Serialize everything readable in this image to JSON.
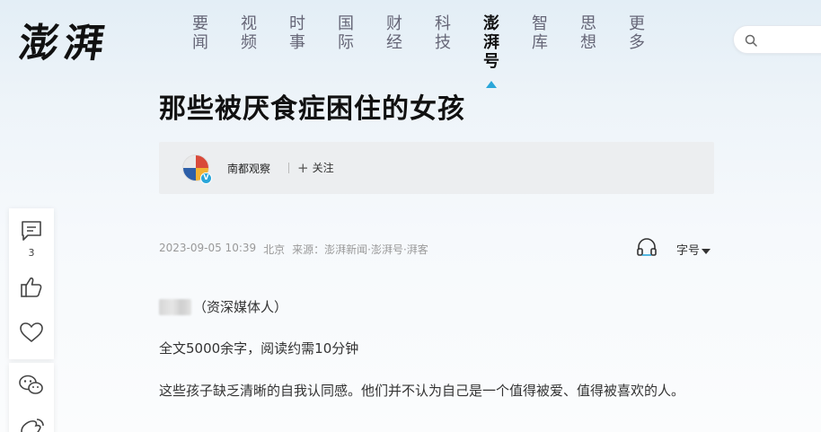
{
  "brand": {
    "logo_text": "澎湃"
  },
  "nav": {
    "items": [
      {
        "label": [
          "要",
          "闻"
        ],
        "active": false
      },
      {
        "label": [
          "视",
          "频"
        ],
        "active": false
      },
      {
        "label": [
          "时",
          "事"
        ],
        "active": false
      },
      {
        "label": [
          "国",
          "际"
        ],
        "active": false
      },
      {
        "label": [
          "财",
          "经"
        ],
        "active": false
      },
      {
        "label": [
          "科",
          "技"
        ],
        "active": false
      },
      {
        "label": [
          "澎",
          "湃",
          "号"
        ],
        "active": true
      },
      {
        "label": [
          "智",
          "库"
        ],
        "active": false
      },
      {
        "label": [
          "思",
          "想"
        ],
        "active": false
      },
      {
        "label": [
          "更",
          "多"
        ],
        "active": false
      }
    ],
    "accent_color": "#2aa6d9"
  },
  "search": {
    "icon": "search-icon"
  },
  "article": {
    "title": "那些被厌食症困住的女孩",
    "author": {
      "name": "南都观察",
      "follow_label": "关注",
      "verified_mark": "V"
    },
    "meta": {
      "datetime": "2023-09-05 10:39",
      "location": "北京",
      "source": "来源：澎湃新闻·澎湃号·湃客"
    },
    "toolbar": {
      "font_size_label": "字号"
    },
    "byline_role": "（资深媒体人）",
    "paragraphs": [
      "全文5000余字，阅读约需10分钟",
      "这些孩子缺乏清晰的自我认同感。他们并不认为自己是一个值得被爱、值得被喜欢的人。"
    ]
  },
  "sidebar": {
    "comment_count": "3",
    "icons": [
      "comment-icon",
      "like-icon",
      "favorite-icon",
      "wechat-share-icon",
      "weibo-share-icon"
    ]
  }
}
